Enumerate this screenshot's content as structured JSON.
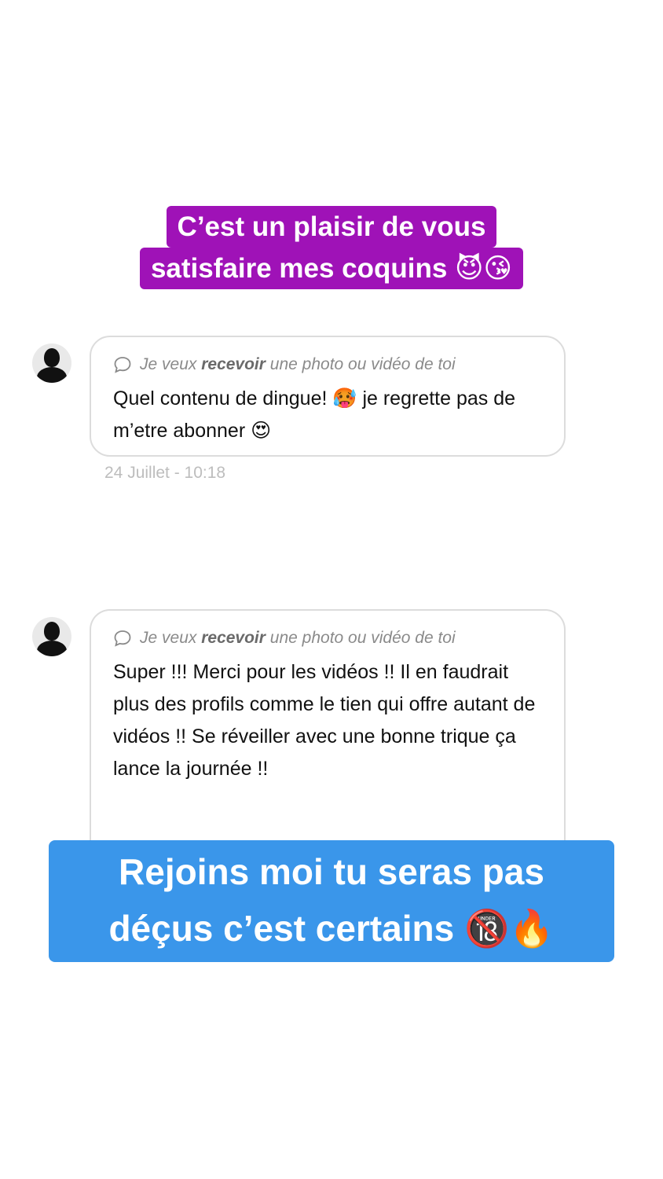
{
  "caption_top": {
    "line1": "C’est un plaisir de vous",
    "line2": "satisfaire mes coquins 😈😘"
  },
  "messages": [
    {
      "request_prefix": "Je veux ",
      "request_bold": "recevoir",
      "request_suffix": " une photo ou vidéo de toi",
      "text": "Quel contenu de dingue! 🥵 je regrette pas de m’etre abonner 😍",
      "timestamp": "24 Juillet - 10:18"
    },
    {
      "request_prefix": "Je veux ",
      "request_bold": "recevoir",
      "request_suffix": " une photo ou vidéo de toi",
      "text": "Super !!! Merci pour les vidéos !! Il en faudrait plus des profils comme le tien qui offre autant de vidéos !! Se réveiller avec une bonne trique ça lance la journée !!"
    }
  ],
  "caption_bottom": {
    "line1": "Rejoins moi tu seras pas",
    "line2": "déçus c’est certains 🔞🔥"
  },
  "icons": {
    "request": "chat-bubble-icon",
    "avatar": "default-user-silhouette"
  },
  "colors": {
    "caption_top_bg": "#9f12b7",
    "caption_bottom_bg": "#3a96ea"
  }
}
